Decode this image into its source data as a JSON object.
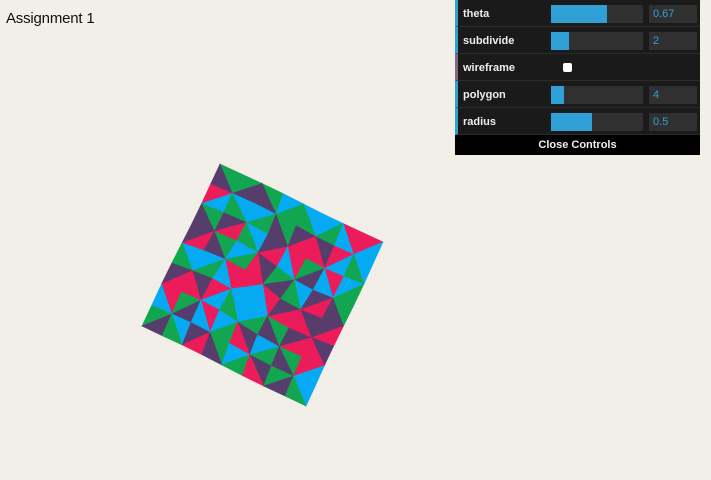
{
  "page": {
    "title": "Assignment 1"
  },
  "controls": {
    "items": [
      {
        "label": "theta",
        "type": "number",
        "value": "0.67",
        "fill": 0.61
      },
      {
        "label": "subdivide",
        "type": "number",
        "value": "2",
        "fill": 0.2
      },
      {
        "label": "wireframe",
        "type": "boolean",
        "checked": false
      },
      {
        "label": "polygon",
        "type": "number",
        "value": "4",
        "fill": 0.14
      },
      {
        "label": "radius",
        "type": "number",
        "value": "0.5",
        "fill": 0.45
      }
    ],
    "close_label": "Close Controls"
  },
  "colors": {
    "background": "#f2eee8",
    "green": "#12a650",
    "purple": "#563d6c",
    "pink": "#ec1c5a",
    "blue": "#05aaf3",
    "accent": "#2fa1d6"
  }
}
